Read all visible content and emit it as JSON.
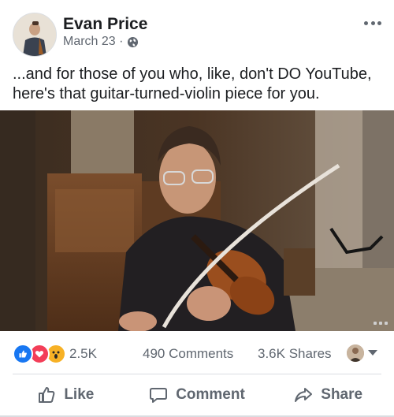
{
  "post": {
    "author": "Evan Price",
    "date": "March 23 ·",
    "text": "...and for those of you who, like, don't DO YouTube, here's that guitar-turned-violin piece for you."
  },
  "stats": {
    "reactions": "2.5K",
    "comments": "490 Comments",
    "shares": "3.6K Shares"
  },
  "actions": {
    "like": "Like",
    "comment": "Comment",
    "share": "Share"
  },
  "icons": {
    "globe": "globe-icon",
    "more": "more-options-icon",
    "like_reaction": "like-reaction-icon",
    "love_reaction": "love-reaction-icon",
    "wow_reaction": "wow-reaction-icon"
  },
  "colors": {
    "like_blue": "#1877f2",
    "love_red": "#f33e58",
    "wow_yellow": "#f7b125",
    "secondary_text": "#606770"
  }
}
